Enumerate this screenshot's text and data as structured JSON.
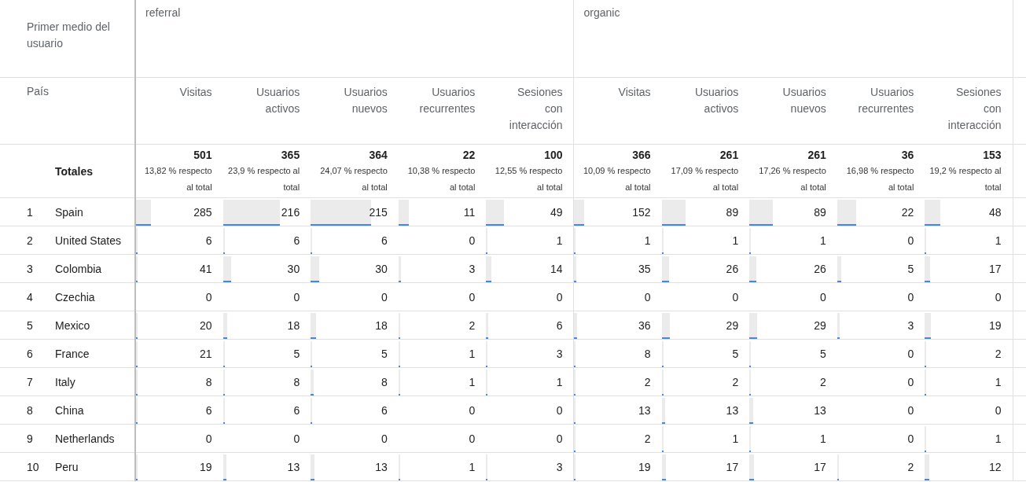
{
  "dimension_header": "Primer medio del usuario",
  "row_dimension_header": "País",
  "groups": [
    {
      "label": "referral",
      "columns": [
        "Visitas",
        "Usuarios activos",
        "Usuarios nuevos",
        "Usuarios recurrentes",
        "Sesiones con interacción"
      ]
    },
    {
      "label": "organic",
      "columns": [
        "Visitas",
        "Usuarios activos",
        "Usuarios nuevos",
        "Usuarios recurrentes",
        "Sesiones con interacción"
      ]
    }
  ],
  "totals": {
    "label": "Totales",
    "cells": [
      {
        "value": "501",
        "share": "13,82 % respecto al total"
      },
      {
        "value": "365",
        "share": "23,9 % respecto al total"
      },
      {
        "value": "364",
        "share": "24,07 % respecto al total"
      },
      {
        "value": "22",
        "share": "10,38 % respecto al total"
      },
      {
        "value": "100",
        "share": "12,55 % respecto al total"
      },
      {
        "value": "366",
        "share": "10,09 % respecto al total"
      },
      {
        "value": "261",
        "share": "17,09 % respecto al total"
      },
      {
        "value": "261",
        "share": "17,26 % respecto al total"
      },
      {
        "value": "36",
        "share": "16,98 % respecto al total"
      },
      {
        "value": "153",
        "share": "19,2 % respecto al total"
      }
    ]
  },
  "rows": [
    {
      "rank": "1",
      "country": "Spain",
      "cells": [
        {
          "value": "285",
          "level": 0.17
        },
        {
          "value": "216",
          "level": 0.65
        },
        {
          "value": "215",
          "level": 0.69
        },
        {
          "value": "11",
          "level": 0.12
        },
        {
          "value": "49",
          "level": 0.2
        },
        {
          "value": "152",
          "level": 0.11
        },
        {
          "value": "89",
          "level": 0.27
        },
        {
          "value": "89",
          "level": 0.27
        },
        {
          "value": "22",
          "level": 0.22
        },
        {
          "value": "48",
          "level": 0.18
        }
      ]
    },
    {
      "rank": "2",
      "country": "United States",
      "cells": [
        {
          "value": "6",
          "level": 0.01
        },
        {
          "value": "6",
          "level": 0.02
        },
        {
          "value": "6",
          "level": 0.02
        },
        {
          "value": "0"
        },
        {
          "value": "1",
          "level": 0.01
        },
        {
          "value": "1",
          "level": 0.01
        },
        {
          "value": "1",
          "level": 0.01
        },
        {
          "value": "1",
          "level": 0.01
        },
        {
          "value": "0"
        },
        {
          "value": "1",
          "level": 0.01
        }
      ]
    },
    {
      "rank": "3",
      "country": "Colombia",
      "cells": [
        {
          "value": "41",
          "level": 0.02
        },
        {
          "value": "30",
          "level": 0.09
        },
        {
          "value": "30",
          "level": 0.1
        },
        {
          "value": "3",
          "level": 0.03
        },
        {
          "value": "14",
          "level": 0.06
        },
        {
          "value": "35",
          "level": 0.02
        },
        {
          "value": "26",
          "level": 0.08
        },
        {
          "value": "26",
          "level": 0.08
        },
        {
          "value": "5",
          "level": 0.05
        },
        {
          "value": "17",
          "level": 0.06
        }
      ]
    },
    {
      "rank": "4",
      "country": "Czechia",
      "cells": [
        {
          "value": "0"
        },
        {
          "value": "0"
        },
        {
          "value": "0"
        },
        {
          "value": "0"
        },
        {
          "value": "0"
        },
        {
          "value": "0"
        },
        {
          "value": "0"
        },
        {
          "value": "0"
        },
        {
          "value": "0"
        },
        {
          "value": "0"
        }
      ]
    },
    {
      "rank": "5",
      "country": "Mexico",
      "cells": [
        {
          "value": "20",
          "level": 0.01
        },
        {
          "value": "18",
          "level": 0.05
        },
        {
          "value": "18",
          "level": 0.06
        },
        {
          "value": "2",
          "level": 0.02
        },
        {
          "value": "6",
          "level": 0.02
        },
        {
          "value": "36",
          "level": 0.03
        },
        {
          "value": "29",
          "level": 0.09
        },
        {
          "value": "29",
          "level": 0.09
        },
        {
          "value": "3",
          "level": 0.03
        },
        {
          "value": "19",
          "level": 0.07
        }
      ]
    },
    {
      "rank": "6",
      "country": "France",
      "cells": [
        {
          "value": "21",
          "level": 0.01
        },
        {
          "value": "5",
          "level": 0.02
        },
        {
          "value": "5",
          "level": 0.02
        },
        {
          "value": "1",
          "level": 0.01
        },
        {
          "value": "3",
          "level": 0.01
        },
        {
          "value": "8",
          "level": 0.01
        },
        {
          "value": "5",
          "level": 0.02
        },
        {
          "value": "5",
          "level": 0.02
        },
        {
          "value": "0"
        },
        {
          "value": "2",
          "level": 0.01
        }
      ]
    },
    {
      "rank": "7",
      "country": "Italy",
      "cells": [
        {
          "value": "8",
          "level": 0.01
        },
        {
          "value": "8",
          "level": 0.02
        },
        {
          "value": "8",
          "level": 0.03
        },
        {
          "value": "1",
          "level": 0.01
        },
        {
          "value": "1",
          "level": 0.01
        },
        {
          "value": "2",
          "level": 0.01
        },
        {
          "value": "2",
          "level": 0.01
        },
        {
          "value": "2",
          "level": 0.01
        },
        {
          "value": "0"
        },
        {
          "value": "1",
          "level": 0.01
        }
      ]
    },
    {
      "rank": "8",
      "country": "China",
      "cells": [
        {
          "value": "6",
          "level": 0.01
        },
        {
          "value": "6",
          "level": 0.02
        },
        {
          "value": "6",
          "level": 0.02
        },
        {
          "value": "0"
        },
        {
          "value": "0"
        },
        {
          "value": "13",
          "level": 0.01
        },
        {
          "value": "13",
          "level": 0.04
        },
        {
          "value": "13",
          "level": 0.04
        },
        {
          "value": "0"
        },
        {
          "value": "0"
        }
      ]
    },
    {
      "rank": "9",
      "country": "Netherlands",
      "cells": [
        {
          "value": "0"
        },
        {
          "value": "0"
        },
        {
          "value": "0"
        },
        {
          "value": "0"
        },
        {
          "value": "0"
        },
        {
          "value": "2",
          "level": 0.01
        },
        {
          "value": "1",
          "level": 0.01
        },
        {
          "value": "1",
          "level": 0.01
        },
        {
          "value": "0"
        },
        {
          "value": "1",
          "level": 0.01
        }
      ]
    },
    {
      "rank": "10",
      "country": "Peru",
      "cells": [
        {
          "value": "19",
          "level": 0.01
        },
        {
          "value": "13",
          "level": 0.04
        },
        {
          "value": "13",
          "level": 0.04
        },
        {
          "value": "1",
          "level": 0.01
        },
        {
          "value": "3",
          "level": 0.01
        },
        {
          "value": "19",
          "level": 0.01
        },
        {
          "value": "17",
          "level": 0.05
        },
        {
          "value": "17",
          "level": 0.05
        },
        {
          "value": "2",
          "level": 0.02
        },
        {
          "value": "12",
          "level": 0.05
        }
      ]
    }
  ]
}
